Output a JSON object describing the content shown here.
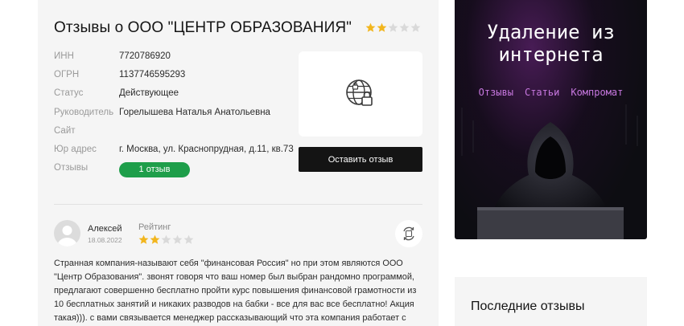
{
  "company": {
    "title": "Отзывы о ООО \"ЦЕНТР ОБРАЗОВАНИЯ\"",
    "rating": 2,
    "max_rating": 5,
    "info": [
      {
        "label": "ИНН",
        "value": "7720786920"
      },
      {
        "label": "ОГРН",
        "value": "1137746595293"
      },
      {
        "label": "Статус",
        "value": "Действующее"
      },
      {
        "label": "Руководитель",
        "value": "Горелышева Наталья Анатольевна"
      },
      {
        "label": "Сайт",
        "value": ""
      },
      {
        "label": "Юр адрес",
        "value": "г. Москва, ул. Краснопрудная, д.11, кв.73"
      },
      {
        "label": "Отзывы",
        "value": "1 отзыв"
      }
    ],
    "logo_icon": "globe-lock-icon",
    "leave_review_label": "Оставить отзыв"
  },
  "review": {
    "author": "Алексей",
    "date": "18.08.2022",
    "rating_label": "Рейтинг",
    "rating": 2,
    "lines": [
      "Странная компания-называют себя \"финансовая Россия\" но при этом являются ООО",
      "\"Центр Образования\". звонят говоря что ваш номер был выбран рандомно программой,",
      "предлагают совершенно бесплатно пройти курс повышения финансовой грамотности из",
      "10 бесплатных занятий и никаких разводов на бабки - все для вас все бесплатно! Акция",
      "такая))). с вами связывается менеджер рассказывающий что эта компания работает с"
    ]
  },
  "ad": {
    "title_line1": "Удаление из",
    "title_line2": "интернета",
    "links": [
      "Отзывы",
      "Статьи",
      "Компромат"
    ]
  },
  "sidebar": {
    "latest_title": "Последние отзывы"
  },
  "colors": {
    "star_filled": "#f2b61e",
    "star_empty": "#d9d9d9",
    "badge_green": "#1e9e4a",
    "ad_link": "#c878e0"
  }
}
